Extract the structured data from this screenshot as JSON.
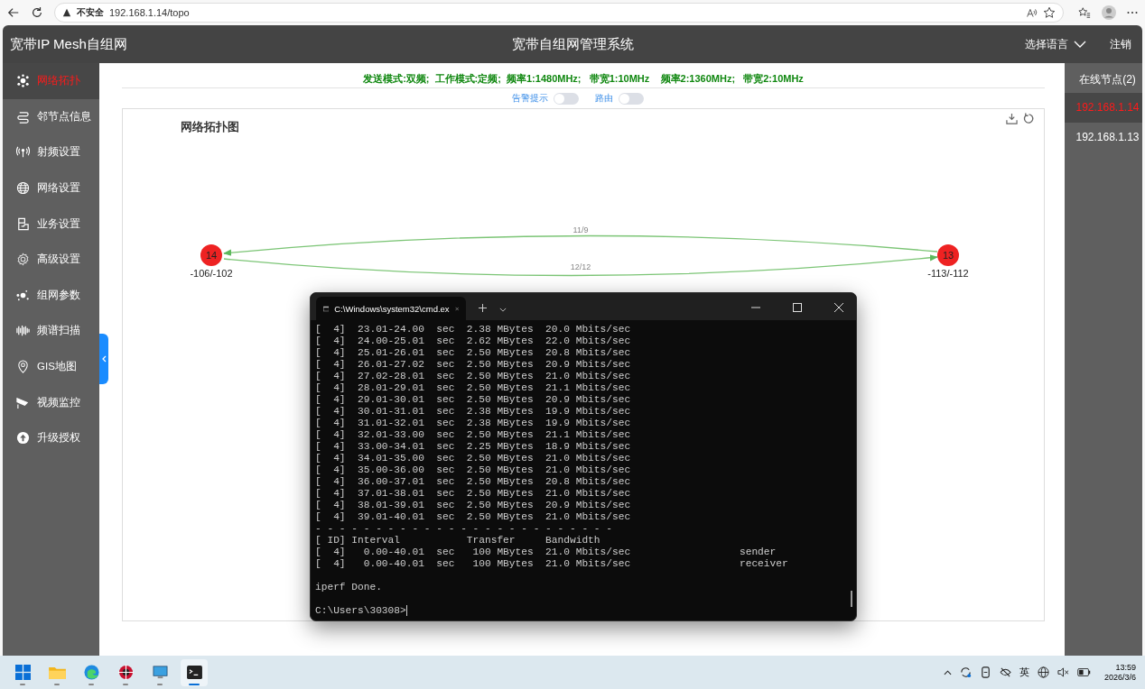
{
  "browser": {
    "security": "不安全",
    "url": "192.168.1.14/topo"
  },
  "header": {
    "brand": "宽带IP Mesh自组网",
    "title": "宽带自组网管理系统",
    "language": "选择语言",
    "logout": "注销"
  },
  "sidebar": {
    "items": [
      {
        "label": "网络拓扑",
        "selected": true
      },
      {
        "label": "邻节点信息",
        "selected": false
      },
      {
        "label": "射频设置",
        "selected": false
      },
      {
        "label": "网络设置",
        "selected": false
      },
      {
        "label": "业务设置",
        "selected": false
      },
      {
        "label": "高级设置",
        "selected": false
      },
      {
        "label": "组网参数",
        "selected": false
      },
      {
        "label": "频谱扫描",
        "selected": false
      },
      {
        "label": "GIS地图",
        "selected": false
      },
      {
        "label": "视频监控",
        "selected": false
      },
      {
        "label": "升级授权",
        "selected": false
      }
    ]
  },
  "status_line": "发送模式:双频;  工作模式:定频;  频率1:1480MHz;   带宽1:10MHz    频率2:1360MHz;   带宽2:10MHz",
  "toggles": [
    {
      "label": "告警提示",
      "on": false
    },
    {
      "label": "路由",
      "on": false
    }
  ],
  "topology": {
    "title": "网络拓扑图",
    "nodes": [
      {
        "label": "14",
        "signal": "-106/-102"
      },
      {
        "label": "13",
        "signal": "-113/-112"
      }
    ],
    "links": [
      {
        "label": "11/9"
      },
      {
        "label": "12/12"
      }
    ]
  },
  "online_nodes": {
    "title": "在线节点(2)",
    "items": [
      {
        "label": "192.168.1.14",
        "selected": true
      },
      {
        "label": "192.168.1.13",
        "selected": false
      }
    ]
  },
  "terminal": {
    "tab_title": "C:\\Windows\\system32\\cmd.ex",
    "intervals": [
      "[  4]  23.01-24.00  sec  2.38 MBytes  20.0 Mbits/sec",
      "[  4]  24.00-25.01  sec  2.62 MBytes  22.0 Mbits/sec",
      "[  4]  25.01-26.01  sec  2.50 MBytes  20.8 Mbits/sec",
      "[  4]  26.01-27.02  sec  2.50 MBytes  20.9 Mbits/sec",
      "[  4]  27.02-28.01  sec  2.50 MBytes  21.0 Mbits/sec",
      "[  4]  28.01-29.01  sec  2.50 MBytes  21.1 Mbits/sec",
      "[  4]  29.01-30.01  sec  2.50 MBytes  20.9 Mbits/sec",
      "[  4]  30.01-31.01  sec  2.38 MBytes  19.9 Mbits/sec",
      "[  4]  31.01-32.01  sec  2.38 MBytes  19.9 Mbits/sec",
      "[  4]  32.01-33.00  sec  2.50 MBytes  21.1 Mbits/sec",
      "[  4]  33.00-34.01  sec  2.25 MBytes  18.9 Mbits/sec",
      "[  4]  34.01-35.00  sec  2.50 MBytes  21.0 Mbits/sec",
      "[  4]  35.00-36.00  sec  2.50 MBytes  21.0 Mbits/sec",
      "[  4]  36.00-37.01  sec  2.50 MBytes  20.8 Mbits/sec",
      "[  4]  37.01-38.01  sec  2.50 MBytes  21.0 Mbits/sec",
      "[  4]  38.01-39.01  sec  2.50 MBytes  20.9 Mbits/sec",
      "[  4]  39.01-40.01  sec  2.50 MBytes  21.0 Mbits/sec"
    ],
    "separator": "- - - - - - - - - - - - - - - - - - - - - - - - -",
    "summary": [
      "[ ID] Interval           Transfer     Bandwidth",
      "[  4]   0.00-40.01  sec   100 MBytes  21.0 Mbits/sec                  sender",
      "[  4]   0.00-40.01  sec   100 MBytes  21.0 Mbits/sec                  receiver"
    ],
    "done": "iperf Done.",
    "prompt": "C:\\Users\\30308>"
  },
  "taskbar": {
    "apps": [
      {
        "selected": false
      },
      {
        "selected": false
      },
      {
        "selected": false
      },
      {
        "selected": false
      },
      {
        "selected": false
      },
      {
        "selected": true
      }
    ],
    "ime": "英",
    "time": "13:59",
    "date": "2026/3/6"
  }
}
